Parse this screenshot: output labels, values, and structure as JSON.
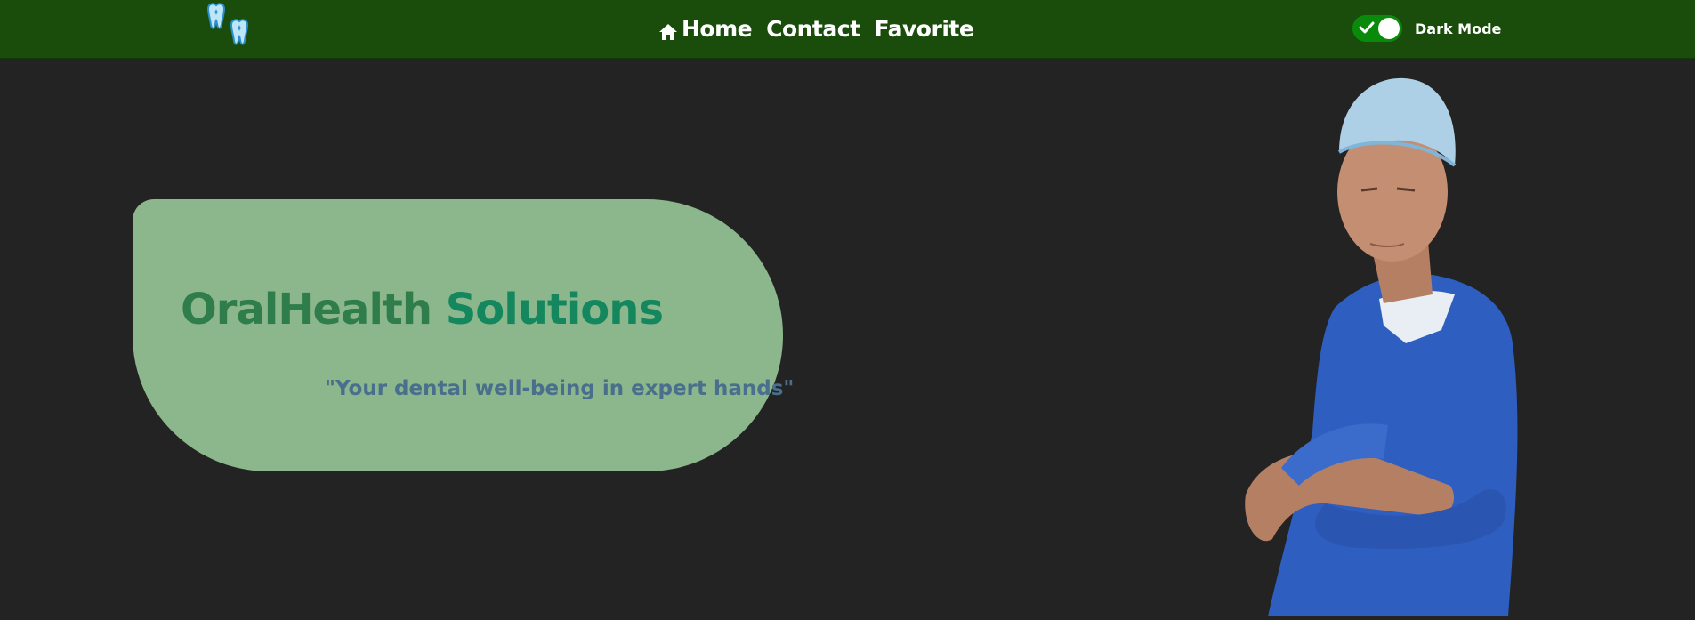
{
  "nav": {
    "logo_icon": "teeth-logo-icon",
    "links": [
      {
        "label": "Home",
        "icon": "home-icon"
      },
      {
        "label": "Contact"
      },
      {
        "label": "Favorite"
      }
    ],
    "dark_mode": {
      "label": "Dark Mode",
      "enabled": true,
      "icon": "check-icon"
    }
  },
  "hero": {
    "title_main": "OralHealth",
    "title_accent": "Solutions",
    "tagline": "\"Your dental well-being in expert hands\"",
    "image": "doctor-in-scrubs-photo"
  },
  "colors": {
    "navbar": "#1a4d0c",
    "background": "#232323",
    "card": "#8cb78c",
    "title": "#2f7d4b",
    "title_accent": "#14875e",
    "tagline": "#4a6f8c",
    "toggle_on": "#0a8a0a"
  }
}
